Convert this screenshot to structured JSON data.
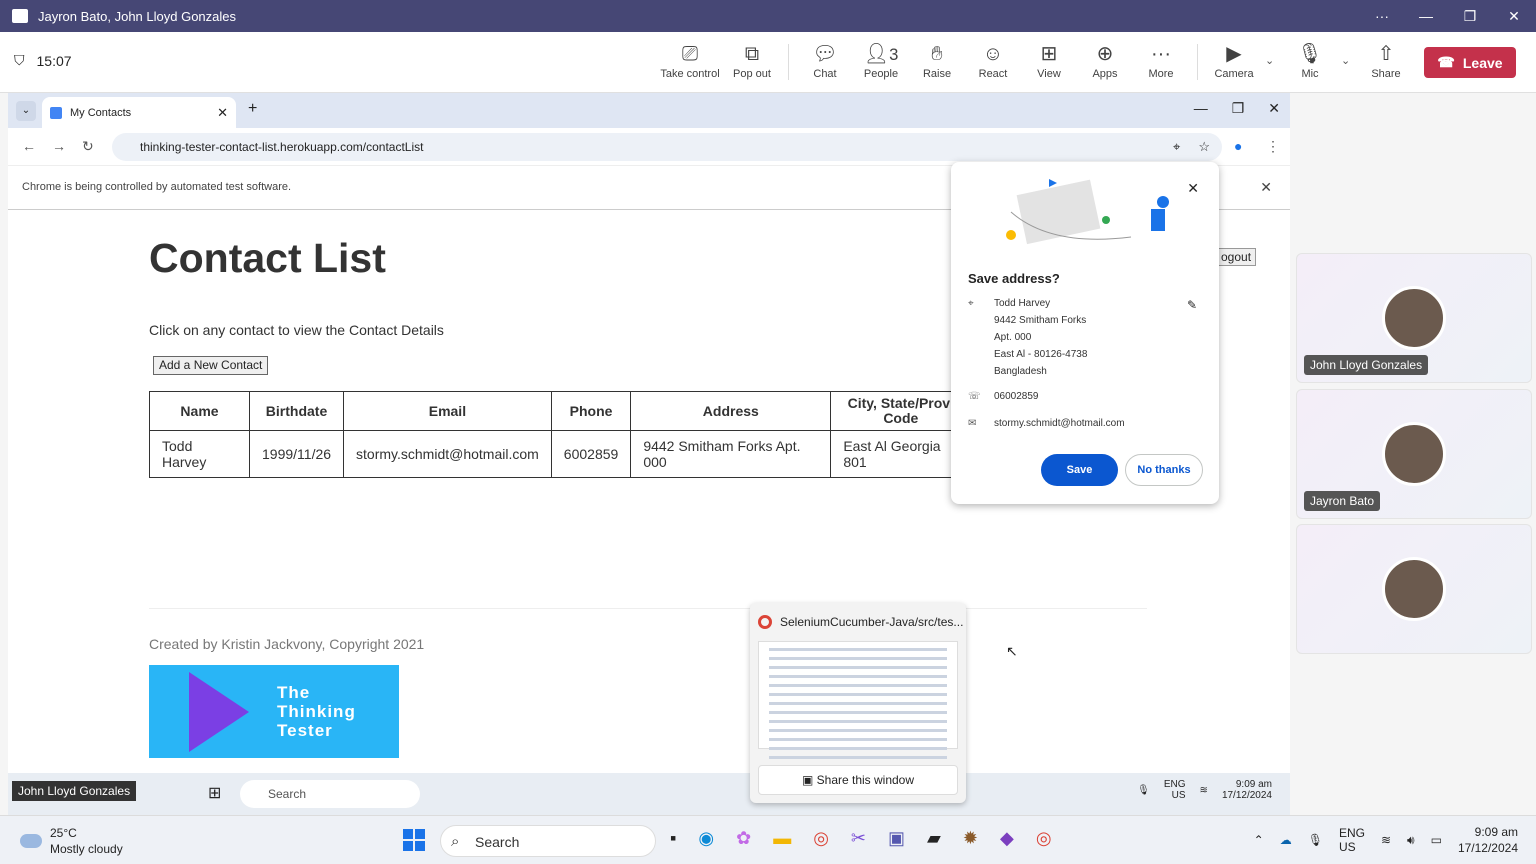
{
  "teams": {
    "window_title": "Jayron Bato, John Lloyd Gonzales",
    "timer": "15:07",
    "buttons": {
      "take_control": "Take control",
      "pop_out": "Pop out",
      "chat": "Chat",
      "people": "People",
      "people_count": "3",
      "raise": "Raise",
      "react": "React",
      "view": "View",
      "apps": "Apps",
      "more": "More",
      "camera": "Camera",
      "mic": "Mic",
      "share": "Share",
      "leave": "Leave"
    },
    "participants": [
      {
        "name": "John Lloyd Gonzales"
      },
      {
        "name": "Jayron Bato"
      },
      {
        "name": ""
      }
    ]
  },
  "browser": {
    "tab_title": "My Contacts",
    "url": "thinking-tester-contact-list.herokuapp.com/contactList",
    "infobar": "Chrome is being controlled by automated test software."
  },
  "page": {
    "heading": "Contact List",
    "subtitle": "Click on any contact to view the Contact Details",
    "add_button": "Add a New Contact",
    "logout_button": "ogout",
    "table": {
      "headers": [
        "Name",
        "Birthdate",
        "Email",
        "Phone",
        "Address",
        "City, State/Provi Code"
      ],
      "rows": [
        [
          "Todd Harvey",
          "1999/11/26",
          "stormy.schmidt@hotmail.com",
          "6002859",
          "9442 Smitham Forks Apt. 000",
          "East Al Georgia 801"
        ]
      ]
    },
    "footer": "Created by Kristin Jackvony, Copyright 2021",
    "logo_text": [
      "The",
      "Thinking",
      "Tester"
    ]
  },
  "save_popup": {
    "title": "Save address?",
    "address_lines": [
      "Todd Harvey",
      "9442 Smitham Forks",
      "Apt. 000",
      "East Al - 80126-4738",
      "Bangladesh"
    ],
    "phone": "06002859",
    "email": "stormy.schmidt@hotmail.com",
    "save_label": "Save",
    "no_label": "No thanks"
  },
  "thumbnail": {
    "title": "SeleniumCucumber-Java/src/tes...",
    "share_label": "Share this window"
  },
  "inner_taskbar": {
    "presenter": "John Lloyd Gonzales",
    "weather_partial": "Mostly cloudy",
    "search": "Search",
    "lang": "ENG",
    "region": "US",
    "time": "9:09 am",
    "date": "17/12/2024"
  },
  "taskbar": {
    "temp": "25°C",
    "weather": "Mostly cloudy",
    "search": "Search",
    "lang": "ENG",
    "region": "US",
    "time": "9:09 am",
    "date": "17/12/2024"
  }
}
